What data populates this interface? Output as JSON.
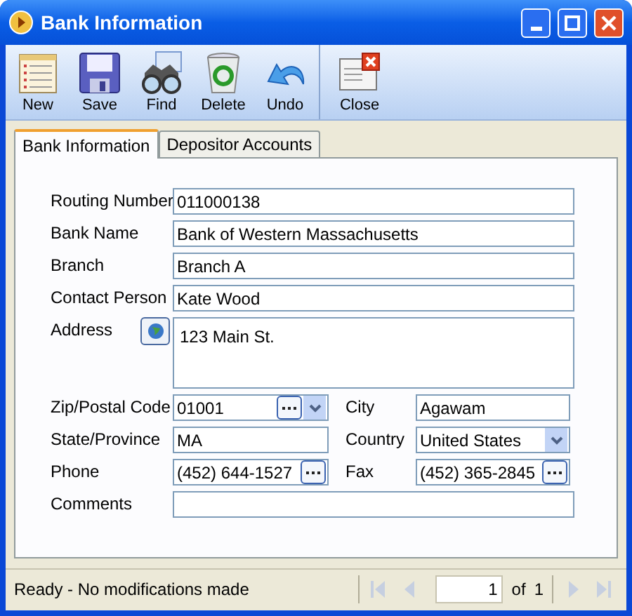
{
  "window": {
    "title": "Bank Information"
  },
  "toolbar": {
    "groups": [
      [
        {
          "label": "New",
          "kind": "new"
        },
        {
          "label": "Save",
          "kind": "save"
        },
        {
          "label": "Find",
          "kind": "find"
        },
        {
          "label": "Delete",
          "kind": "delete"
        },
        {
          "label": "Undo",
          "kind": "undo"
        }
      ],
      [
        {
          "label": "Close",
          "kind": "close"
        }
      ]
    ]
  },
  "tabs": [
    {
      "label": "Bank Information",
      "selected": true
    },
    {
      "label": "Depositor Accounts",
      "selected": false
    }
  ],
  "form": {
    "rows": [
      [
        {
          "label": "Routing Number",
          "value": "011000138",
          "kind": "text"
        }
      ],
      [
        {
          "label": "Bank Name",
          "value": "Bank of Western Massachusetts",
          "kind": "text"
        }
      ],
      [
        {
          "label": "Branch",
          "value": "Branch A",
          "kind": "text"
        }
      ],
      [
        {
          "label": "Contact Person",
          "value": "Kate Wood",
          "kind": "text"
        }
      ],
      [
        {
          "label": "Address",
          "value": "123 Main St.",
          "kind": "address"
        }
      ],
      [
        {
          "label": "Zip/Postal Code",
          "value": "01001",
          "kind": "lookup-dropdown"
        },
        {
          "label": "City",
          "value": "Agawam",
          "kind": "text"
        }
      ],
      [
        {
          "label": "State/Province",
          "value": "MA",
          "kind": "text"
        },
        {
          "label": "Country",
          "value": "United States",
          "kind": "dropdown"
        }
      ],
      [
        {
          "label": "Phone",
          "value": "(452) 644-1527",
          "kind": "lookup"
        },
        {
          "label": "Fax",
          "value": "(452) 365-2845",
          "kind": "lookup"
        }
      ],
      [
        {
          "label": "Comments",
          "kind": "text"
        }
      ]
    ]
  },
  "status_bar": {
    "message": "Ready - No modifications made",
    "pager": {
      "current": "1",
      "of": "of",
      "total": "1",
      "nav": [
        {
          "kind": "first",
          "disabled": true
        },
        {
          "kind": "prev",
          "disabled": true
        },
        {
          "kind": "next",
          "disabled": true
        },
        {
          "kind": "last",
          "disabled": true
        }
      ]
    }
  }
}
